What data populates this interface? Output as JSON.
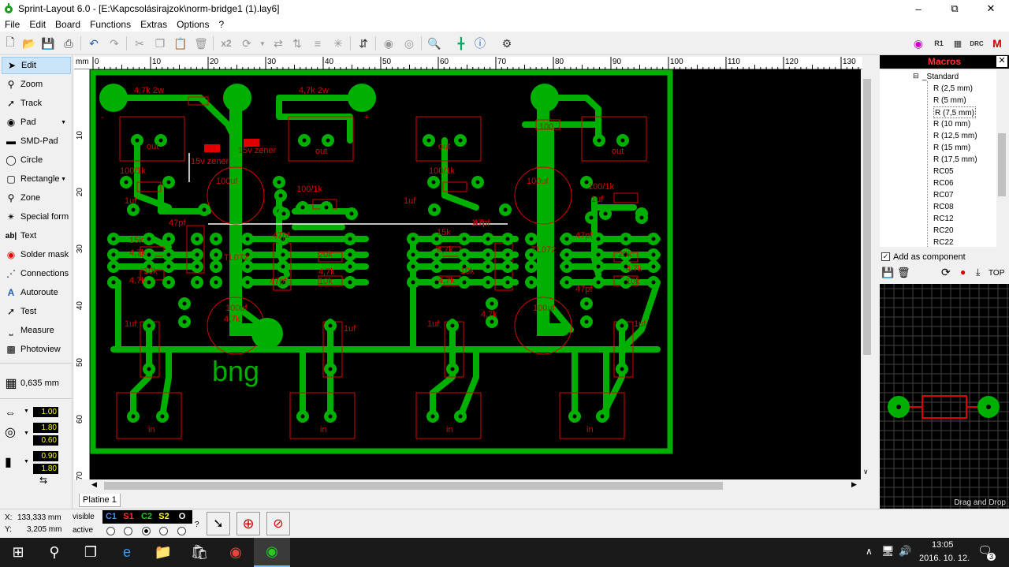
{
  "window": {
    "title": "Sprint-Layout 6.0 - [E:\\Kapcsolásirajzok\\norm-bridge1 (1).lay6]"
  },
  "menu": [
    "File",
    "Edit",
    "Board",
    "Functions",
    "Extras",
    "Options",
    "?"
  ],
  "toolbar": {
    "copies_label": "x2"
  },
  "tools": [
    {
      "label": "Edit",
      "icon": "cursor-icon"
    },
    {
      "label": "Zoom",
      "icon": "magnifier-icon"
    },
    {
      "label": "Track",
      "icon": "track-icon"
    },
    {
      "label": "Pad",
      "icon": "pad-icon"
    },
    {
      "label": "SMD-Pad",
      "icon": "smd-pad-icon"
    },
    {
      "label": "Circle",
      "icon": "circle-icon"
    },
    {
      "label": "Rectangle",
      "icon": "rectangle-icon"
    },
    {
      "label": "Zone",
      "icon": "zone-icon"
    },
    {
      "label": "Special form",
      "icon": "special-form-icon"
    },
    {
      "label": "Text",
      "icon": "text-icon"
    },
    {
      "label": "Solder mask",
      "icon": "solder-mask-icon"
    },
    {
      "label": "Connections",
      "icon": "connections-icon"
    },
    {
      "label": "Autoroute",
      "icon": "autoroute-icon"
    },
    {
      "label": "Test",
      "icon": "test-icon"
    },
    {
      "label": "Measure",
      "icon": "measure-icon"
    },
    {
      "label": "Photoview",
      "icon": "photoview-icon"
    }
  ],
  "grid": "0,635 mm",
  "widths": {
    "track": "1.00",
    "pad_outer": "1.80",
    "pad_inner": "0.60",
    "smd_w": "0.90",
    "smd_h": "1.80"
  },
  "ruler": {
    "unit": "mm",
    "top": [
      "0",
      "10",
      "20",
      "30",
      "40",
      "50",
      "60",
      "70",
      "80",
      "90",
      "100",
      "110",
      "120",
      "130"
    ],
    "left": [
      "10",
      "20",
      "30",
      "40",
      "50",
      "60",
      "70"
    ]
  },
  "board_labels": [
    {
      "text": "4,7k 2w"
    },
    {
      "text": "4,7k 2w"
    },
    {
      "text": "-"
    },
    {
      "text": "+"
    },
    {
      "text": "out"
    },
    {
      "text": "out"
    },
    {
      "text": "out"
    },
    {
      "text": "out"
    },
    {
      "text": "100/1k"
    },
    {
      "text": "100/1k"
    },
    {
      "text": "100/1k"
    },
    {
      "text": "100/1k"
    },
    {
      "text": "15v zener"
    },
    {
      "text": "15v zener"
    },
    {
      "text": "1uf"
    },
    {
      "text": "1uf"
    },
    {
      "text": "1uf"
    },
    {
      "text": "1uf"
    },
    {
      "text": "100uf"
    },
    {
      "text": "100uf"
    },
    {
      "text": "100uf"
    },
    {
      "text": "100uf"
    },
    {
      "text": "47pf"
    },
    {
      "text": "47pf"
    },
    {
      "text": "47pf"
    },
    {
      "text": "47pf"
    },
    {
      "text": "47pf"
    },
    {
      "text": "47pf"
    },
    {
      "text": "TL072"
    },
    {
      "text": "TL072"
    },
    {
      "text": "15k"
    },
    {
      "text": "15k"
    },
    {
      "text": "4,7k"
    },
    {
      "text": "4,7k"
    },
    {
      "text": "4,7k"
    },
    {
      "text": "4,7k"
    },
    {
      "text": "4,7k"
    },
    {
      "text": "4,7k"
    },
    {
      "text": "4,7k"
    },
    {
      "text": "4,7k"
    },
    {
      "text": "10k"
    },
    {
      "text": "10k"
    },
    {
      "text": "10k"
    },
    {
      "text": "10k"
    },
    {
      "text": "20k"
    },
    {
      "text": "20k"
    },
    {
      "text": "1uf"
    },
    {
      "text": "1uf"
    },
    {
      "text": "1uf"
    },
    {
      "text": "1uf"
    },
    {
      "text": "in"
    },
    {
      "text": "in"
    },
    {
      "text": "in"
    },
    {
      "text": "in"
    },
    {
      "text": "bng"
    },
    {
      "text": "100"
    }
  ],
  "sheet_tab": "Platine 1",
  "macros": {
    "title": "Macros",
    "root": "_Standard",
    "items": [
      "R (2,5 mm)",
      "R (5 mm)",
      "R (7,5 mm)",
      "R (10 mm)",
      "R (12,5 mm)",
      "R (15 mm)",
      "R (17,5 mm)",
      "RC05",
      "RC06",
      "RC07",
      "RC08",
      "RC12",
      "RC20",
      "RC22"
    ],
    "add_as_component": "Add as component",
    "top_label": "TOP",
    "drag_drop": "Drag and Drop"
  },
  "status": {
    "x_label": "X:",
    "x_value": "133,333 mm",
    "y_label": "Y:",
    "y_value": "3,205 mm",
    "visible": "visible",
    "active": "active",
    "layers": [
      {
        "name": "C1",
        "color": "#4a8cff"
      },
      {
        "name": "S1",
        "color": "#ff3030"
      },
      {
        "name": "C2",
        "color": "#22cc22"
      },
      {
        "name": "S2",
        "color": "#ffff00"
      },
      {
        "name": "O",
        "color": "#ffffff"
      }
    ],
    "question": "?"
  },
  "taskbar": {
    "time": "13:05",
    "date": "2016. 10. 12.",
    "notif": "3"
  },
  "colors": {
    "copper": "#00b000",
    "silk": "#e00000"
  }
}
